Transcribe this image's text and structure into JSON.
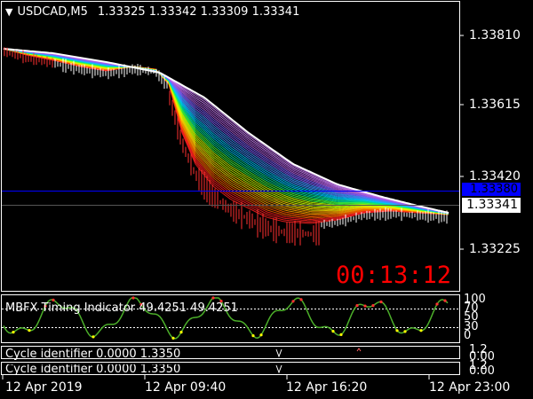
{
  "main_chart": {
    "symbol": "USDCAD,M5",
    "ohlc": [
      "1.33325",
      "1.33342",
      "1.33309",
      "1.33341"
    ],
    "countdown": "00:13:12",
    "price_labels": [
      "1.33810",
      "1.33615",
      "1.33420",
      "1.33225"
    ],
    "level_line_price": "1.33380",
    "current_price": "1.33341"
  },
  "timing_panel": {
    "title": "MBFX Timing Indicator 49.4251 49.4251",
    "scale_labels": [
      "100",
      "70",
      "50",
      "30",
      "0"
    ]
  },
  "cycle_panels": [
    {
      "title": "Cycle identifier 0.0000 1.3350",
      "scale_labels": [
        "1.2",
        "0.00"
      ]
    },
    {
      "title": "Cycle identifier 0.0000 1.3350",
      "scale_labels": [
        "1.2",
        "0.00"
      ]
    }
  ],
  "time_axis": [
    "12 Apr 2019",
    "12 Apr 09:40",
    "12 Apr 16:20",
    "12 Apr 23:00"
  ],
  "colors": {
    "background": "#000000",
    "grid": "#ffffff",
    "level_line": "#0000ff",
    "current_price_box": "#ffffff",
    "level_badge": "#0000ff",
    "countdown": "#ff0000",
    "timing_line": "#4caf2a",
    "timing_dots": "#ffff00",
    "timing_dots_red": "#ff3030"
  },
  "icons": {
    "dropdown": "triangle-down-icon"
  }
}
